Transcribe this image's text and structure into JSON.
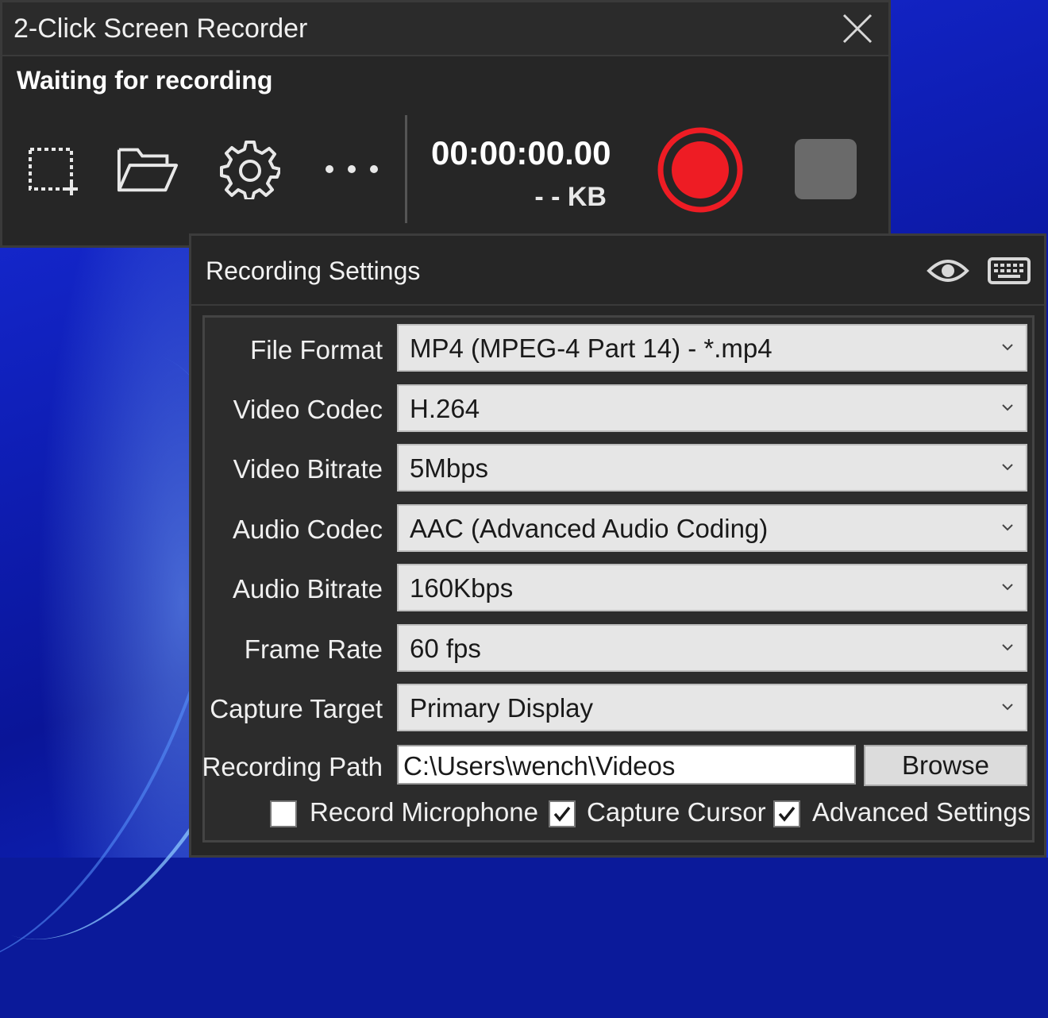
{
  "window": {
    "title": "2-Click Screen Recorder",
    "status": "Waiting for recording"
  },
  "toolbar": {
    "icons": [
      "select-region-icon",
      "folder-open-icon",
      "gear-icon",
      "more-icon"
    ],
    "more_label": "• • •"
  },
  "recording": {
    "timer": "00:00:00.00",
    "size": "- - KB",
    "record_color": "#ee1c24",
    "stop_color": "#6a6a6a"
  },
  "settings": {
    "title": "Recording Settings",
    "fields": [
      {
        "label": "File Format",
        "value": "MP4 (MPEG-4 Part 14) - *.mp4"
      },
      {
        "label": "Video Codec",
        "value": "H.264"
      },
      {
        "label": "Video Bitrate",
        "value": "5Mbps"
      },
      {
        "label": "Audio Codec",
        "value": "AAC (Advanced Audio Coding)"
      },
      {
        "label": "Audio Bitrate",
        "value": "160Kbps"
      },
      {
        "label": "Frame Rate",
        "value": "60 fps"
      },
      {
        "label": "Capture Target",
        "value": "Primary Display"
      }
    ],
    "path": {
      "label": "Recording Path",
      "value": "C:\\Users\\wench\\Videos",
      "browse_label": "Browse"
    },
    "checkboxes": [
      {
        "label": "Record Microphone",
        "checked": false
      },
      {
        "label": "Capture Cursor",
        "checked": true
      },
      {
        "label": "Advanced Settings",
        "checked": true
      }
    ]
  }
}
